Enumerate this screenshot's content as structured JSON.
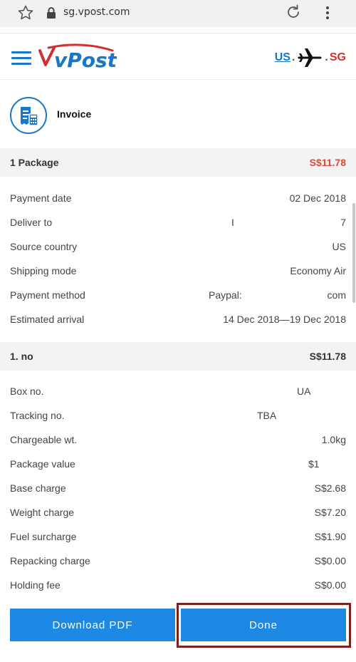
{
  "browser": {
    "url": "sg.vpost.com"
  },
  "header": {
    "logo_text": "vPost",
    "route_from": "US",
    "route_to": "SG",
    "route_dots": ". ."
  },
  "invoice": {
    "title": "Invoice"
  },
  "package_summary": {
    "label": "1 Package",
    "total": "S$11.78",
    "rows": [
      {
        "label": "Payment date",
        "value": "02 Dec 2018"
      },
      {
        "label": "Deliver to",
        "value": "7",
        "partial": "I"
      },
      {
        "label": "Source country",
        "value": "US"
      },
      {
        "label": "Shipping mode",
        "value": "Economy Air"
      },
      {
        "label": "Payment method",
        "value": "com",
        "partial": "Paypal:"
      },
      {
        "label": "Estimated arrival",
        "value": "14 Dec 2018—19 Dec 2018"
      }
    ]
  },
  "item": {
    "label": "1. no",
    "total": "S$11.78",
    "rows": [
      {
        "label": "Box no.",
        "value": "",
        "partial": "UA"
      },
      {
        "label": "Tracking no.",
        "value": "",
        "partial": "TBA"
      },
      {
        "label": "Chargeable wt.",
        "value": "1.0kg"
      },
      {
        "label": "Package value",
        "value": "",
        "partial": "$1"
      },
      {
        "label": "Base charge",
        "value": "S$2.68"
      },
      {
        "label": "Weight charge",
        "value": "S$7.20"
      },
      {
        "label": "Fuel surcharge",
        "value": "S$1.90"
      },
      {
        "label": "Repacking charge",
        "value": "S$0.00"
      },
      {
        "label": "Holding fee",
        "value": "S$0.00"
      }
    ]
  },
  "buttons": {
    "download_pdf": "Download PDF",
    "done": "Done"
  },
  "colors": {
    "brand_blue": "#1e88e5",
    "price_red": "#d94a3a",
    "route_red": "#d32f2f"
  }
}
